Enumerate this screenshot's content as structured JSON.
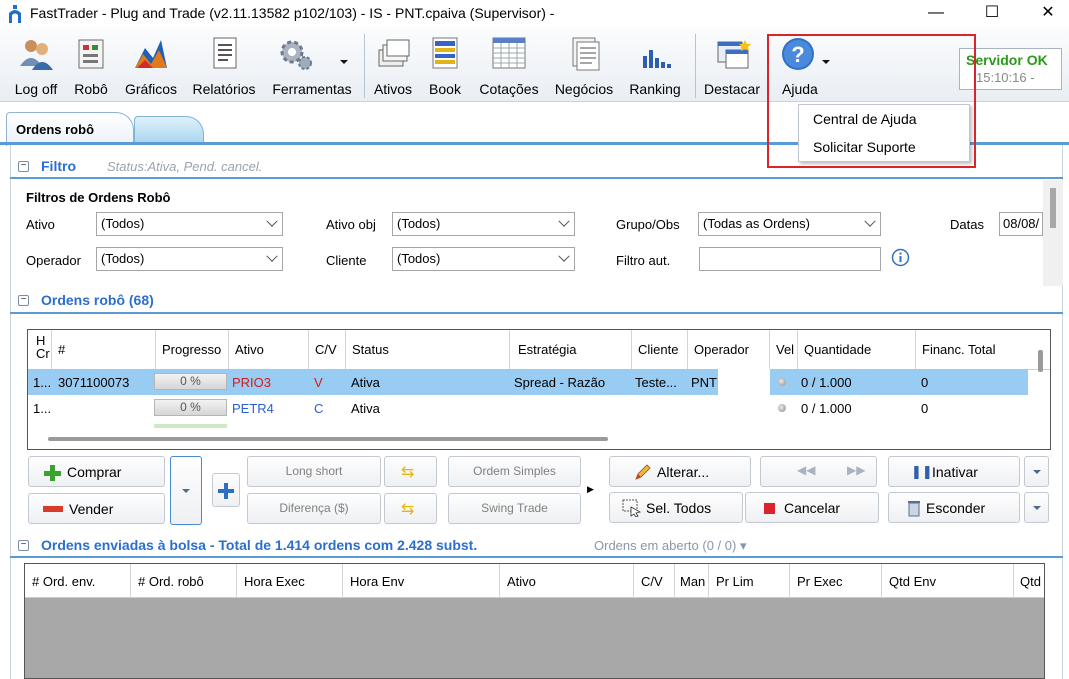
{
  "window": {
    "title": "FastTrader - Plug and Trade (v2.11.13582 p102/103) - IS - PNT.cpaiva (Supervisor) -",
    "minimize": "—",
    "maximize": "☐",
    "close": "✕"
  },
  "toolbar": {
    "buttons": [
      {
        "label": "Log off",
        "icon": "users-icon"
      },
      {
        "label": "Robô",
        "icon": "robot-icon"
      },
      {
        "label": "Gráficos",
        "icon": "chart-icon"
      },
      {
        "label": "Relatórios",
        "icon": "report-icon"
      },
      {
        "label": "Ferramentas",
        "icon": "gear-icon"
      },
      {
        "label": "Ativos",
        "icon": "assets-icon"
      },
      {
        "label": "Book",
        "icon": "book-icon"
      },
      {
        "label": "Cotações",
        "icon": "quotes-icon"
      },
      {
        "label": "Negócios",
        "icon": "trades-icon"
      },
      {
        "label": "Ranking",
        "icon": "ranking-icon"
      },
      {
        "label": "Destacar",
        "icon": "detach-icon"
      },
      {
        "label": "Ajuda",
        "icon": "help-icon"
      }
    ],
    "server_status": "Servidor OK",
    "server_time": "15:10:16 -"
  },
  "help_menu": {
    "items": [
      "Central de Ajuda",
      "Solicitar Suporte"
    ]
  },
  "tabs": {
    "active": "Ordens robô"
  },
  "filter": {
    "title": "Filtro",
    "status_text": "Status:Ativa, Pend. cancel.",
    "heading": "Filtros de Ordens Robô",
    "ativo_label": "Ativo",
    "ativo_value": "(Todos)",
    "ativo_obj_label": "Ativo obj",
    "ativo_obj_value": "(Todos)",
    "grupo_label": "Grupo/Obs",
    "grupo_value": "(Todas as Ordens)",
    "datas_label": "Datas",
    "datas_value": "08/08/",
    "operador_label": "Operador",
    "operador_value": "(Todos)",
    "cliente_label": "Cliente",
    "cliente_value": "(Todos)",
    "filtro_aut_label": "Filtro aut.",
    "filtro_aut_value": ""
  },
  "orders": {
    "title": "Ordens robô (68)",
    "columns": [
      "H\nCr",
      "#",
      "Progresso",
      "Ativo",
      "C/V",
      "Status",
      "Estratégia",
      "Cliente",
      "Operador",
      "Vel",
      "Quantidade",
      "Financ. Total"
    ],
    "rows": [
      {
        "h": "1...",
        "id": "3071100073",
        "progress": "0 %",
        "ativo": "PRIO3",
        "cv": "V",
        "status": "Ativa",
        "estrategia": "Spread - Razão",
        "cliente": "Teste...",
        "operador": "PNT",
        "quantidade": "0 / 1.000",
        "financ": "0"
      },
      {
        "h": "1...",
        "id": "",
        "progress": "0 %",
        "ativo": "PETR4",
        "cv": "C",
        "status": "Ativa",
        "estrategia": "",
        "cliente": "",
        "operador": "",
        "quantidade": "0 / 1.000",
        "financ": "0"
      }
    ]
  },
  "actions": {
    "comprar": "Comprar",
    "vender": "Vender",
    "long_short": "Long short",
    "diferenca": "Diferença ($)",
    "ordem_simples": "Ordem Simples",
    "swing_trade": "Swing Trade",
    "alterar": "Alterar...",
    "sel_todos": "Sel. Todos",
    "cancelar": "Cancelar",
    "inativar": "Inativar",
    "esconder": "Esconder"
  },
  "sent": {
    "title": "Ordens enviadas à bolsa - Total de 1.414 ordens com 2.428 subst.",
    "open_orders": "Ordens em aberto (0 / 0) ▾",
    "columns": [
      "# Ord. env.",
      "# Ord. robô",
      "Hora Exec",
      "Hora Env",
      "Ativo",
      "C/V",
      "Man",
      "Pr Lim",
      "Pr Exec",
      "Qtd Env",
      "Qtd"
    ]
  },
  "colors": {
    "accent": "#2a6fcf",
    "selection": "#99ccf3",
    "server_ok": "#2a9a1a",
    "highlight_box": "#d9242b",
    "sell": "#d01c1c",
    "buy": "#2a5fd0"
  }
}
